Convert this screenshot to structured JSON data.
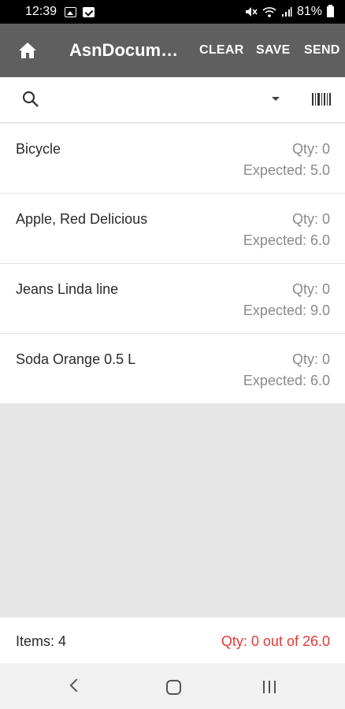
{
  "status_bar": {
    "time": "12:39",
    "battery": "81%"
  },
  "app_bar": {
    "title": "AsnDocum…",
    "clear_label": "CLEAR",
    "save_label": "SAVE",
    "send_label": "SEND"
  },
  "items": [
    {
      "name": "Bicycle",
      "qty": "Qty: 0",
      "expected": "Expected: 5.0"
    },
    {
      "name": "Apple, Red Delicious",
      "qty": "Qty: 0",
      "expected": "Expected: 6.0"
    },
    {
      "name": "Jeans Linda line",
      "qty": "Qty: 0",
      "expected": "Expected: 9.0"
    },
    {
      "name": "Soda Orange 0.5 L",
      "qty": "Qty: 0",
      "expected": "Expected: 6.0"
    }
  ],
  "footer": {
    "items_count": "Items: 4",
    "total_qty": "Qty: 0 out of 26.0"
  },
  "colors": {
    "app_bar": "#5f5f5f",
    "total_qty": "#e53935"
  }
}
